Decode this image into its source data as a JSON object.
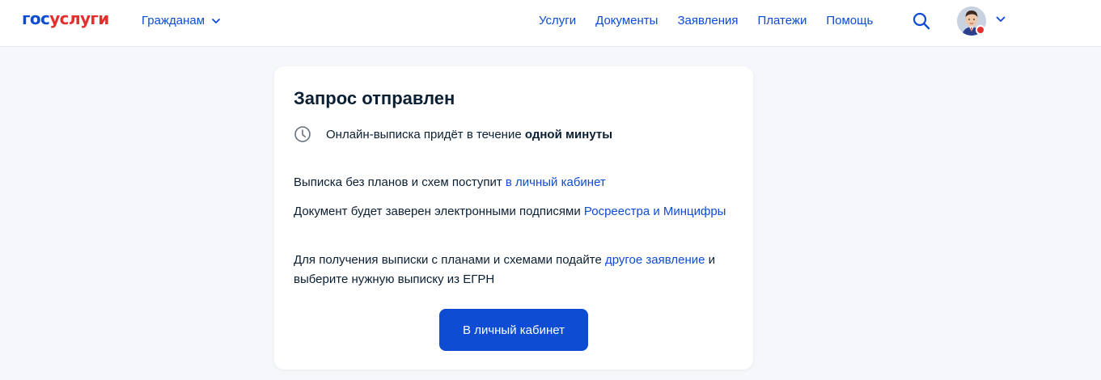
{
  "header": {
    "logo_part1": "гос",
    "logo_part2": "услуги",
    "audience_label": "Гражданам",
    "nav": [
      "Услуги",
      "Документы",
      "Заявления",
      "Платежи",
      "Помощь"
    ],
    "search_icon": "search-icon",
    "avatar_icon": "user-avatar"
  },
  "card": {
    "title": "Запрос отправлен",
    "timer_text": "Онлайн-выписка придёт в течение ",
    "timer_bold": "одной минуты",
    "p1_text": "Выписка без планов и схем поступит ",
    "p1_link": "в личный кабинет",
    "p2_text": "Документ будет заверен электронными подписями ",
    "p2_link": "Росреестра и Минцифры",
    "p3_text": "Для получения выписки с планами и схемами подайте ",
    "p3_link": "другое заявление",
    "p3_tail": " и выберите нужную выписку из ЕГРН",
    "button": "В личный кабинет"
  },
  "colors": {
    "brand_blue": "#0d4cd3",
    "brand_red": "#e3302f",
    "page_bg": "#f5f7fa",
    "text": "#0b1f33"
  }
}
